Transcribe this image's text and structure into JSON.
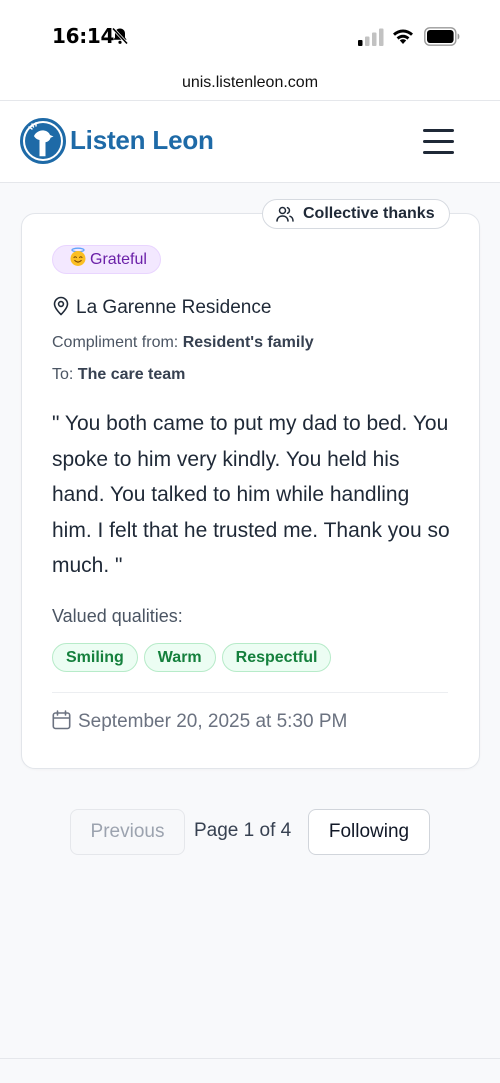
{
  "status_bar": {
    "time": "16:14",
    "icons": [
      "bell-slash-icon",
      "signal-icon",
      "wifi-icon",
      "battery-icon"
    ]
  },
  "browser": {
    "url": "unis.listenleon.com"
  },
  "header": {
    "brand": "Listen Leon",
    "brand_color": "#1e6aa7",
    "menu_icon": "hamburger-menu-icon"
  },
  "card": {
    "badge": "Collective thanks",
    "mood": "Grateful",
    "mood_emoji": "smiling-face-with-halo",
    "location": "La Garenne Residence",
    "from_label": "Compliment from:",
    "from_value": "Resident's family",
    "to_label": "To:",
    "to_value": "The care team",
    "quote": "\" You both came to put my dad to bed. You spoke to him very kindly. You held his hand. You talked to him while handling him. I felt that he trusted me. Thank you so much. \"",
    "qualities_label": "Valued qualities:",
    "qualities": [
      "Smiling",
      "Warm",
      "Respectful"
    ],
    "date": "September 20, 2025 at 5:30 PM"
  },
  "pagination": {
    "previous": "Previous",
    "page_text": "Page 1 of 4",
    "next": "Following"
  }
}
